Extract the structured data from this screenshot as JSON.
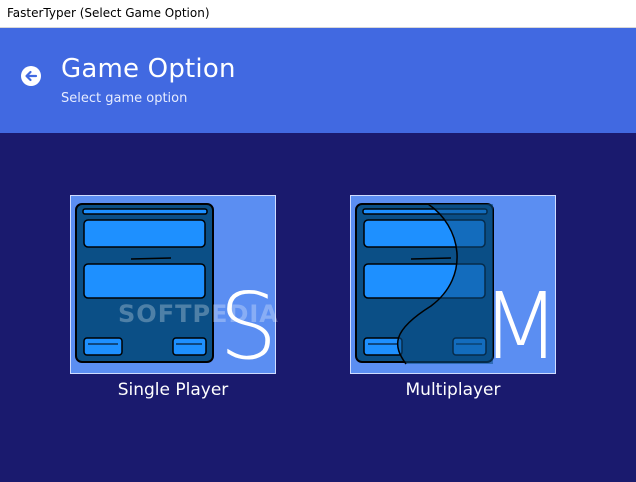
{
  "window": {
    "title": "FasterTyper (Select Game Option)"
  },
  "header": {
    "title": "Game Option",
    "subtitle": "Select game option",
    "back_icon": "arrow-left-circle-icon"
  },
  "options": [
    {
      "label": "Single Player",
      "letter": "S"
    },
    {
      "label": "Multiplayer",
      "letter": "M"
    }
  ],
  "watermark": "SOFTPEDIA",
  "colors": {
    "header": "#4169e1",
    "background": "#1a1a6e",
    "tile": "#5b8ef2",
    "panel": "#0b4f86",
    "field": "#1e90ff"
  }
}
